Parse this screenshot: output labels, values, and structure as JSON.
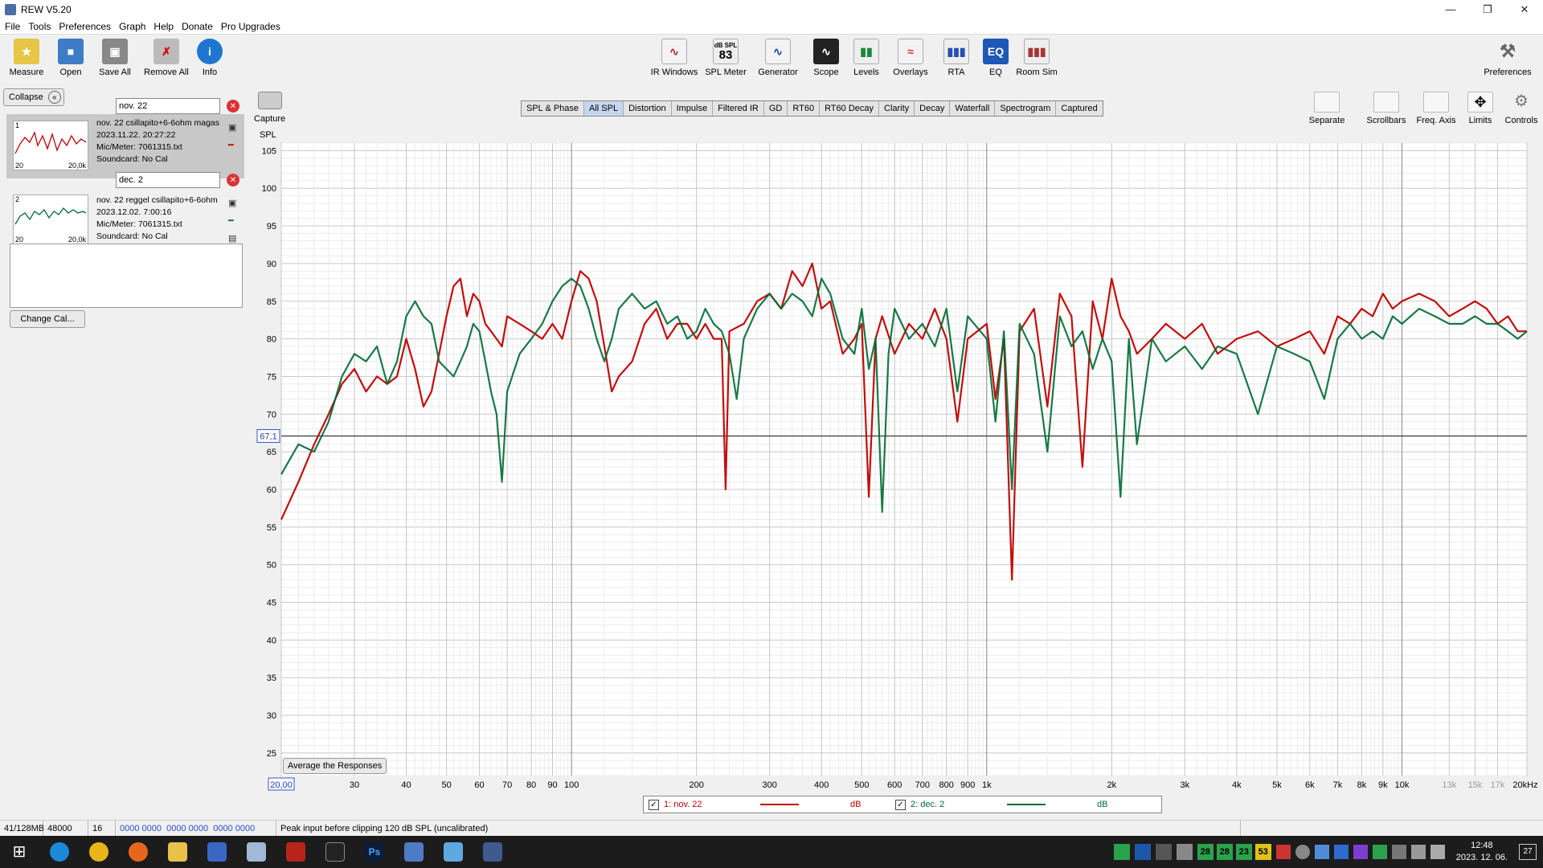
{
  "window": {
    "title": "REW V5.20"
  },
  "menu": [
    "File",
    "Tools",
    "Preferences",
    "Graph",
    "Help",
    "Donate",
    "Pro Upgrades"
  ],
  "toolbar_left": [
    {
      "label": "Measure",
      "icon": "measure-icon"
    },
    {
      "label": "Open",
      "icon": "folder-icon"
    },
    {
      "label": "Save All",
      "icon": "save-icon"
    },
    {
      "label": "Remove All",
      "icon": "remove-icon"
    },
    {
      "label": "Info",
      "icon": "info-icon"
    }
  ],
  "toolbar_center": [
    {
      "label": "IR Windows",
      "icon": "ir-windows-icon"
    },
    {
      "label": "SPL Meter",
      "icon": "spl-meter-icon",
      "badge_top": "dB SPL",
      "badge_value": "83"
    },
    {
      "label": "Generator",
      "icon": "generator-icon"
    },
    {
      "label": "Scope",
      "icon": "scope-icon"
    },
    {
      "label": "Levels",
      "icon": "levels-icon"
    },
    {
      "label": "Overlays",
      "icon": "overlays-icon"
    },
    {
      "label": "RTA",
      "icon": "rta-icon"
    },
    {
      "label": "EQ",
      "icon": "eq-icon"
    },
    {
      "label": "Room Sim",
      "icon": "room-sim-icon"
    }
  ],
  "toolbar_right": {
    "label": "Preferences",
    "icon": "wrench-icon"
  },
  "panel": {
    "collapse_label": "Collapse",
    "measurements": [
      {
        "name": "nov. 22",
        "index": "1",
        "info": [
          "nov. 22 csillapito+6-6ohm magas",
          "2023.11.22. 20:27:22",
          "Mic/Meter: 7061315.txt",
          "Soundcard: No Cal"
        ],
        "thumb_left": "20",
        "thumb_right": "20,0k",
        "color": "#c00000"
      },
      {
        "name": "dec. 2",
        "index": "2",
        "info": [
          "nov. 22 reggel csillapito+6-6ohm",
          "2023.12.02. 7:00:16",
          "Mic/Meter: 7061315.txt",
          "Soundcard: No Cal"
        ],
        "thumb_left": "20",
        "thumb_right": "20,0k",
        "color": "#006a33"
      }
    ],
    "change_cal_label": "Change Cal..."
  },
  "capture_label": "Capture",
  "tabs": [
    "SPL & Phase",
    "All SPL",
    "Distortion",
    "Impulse",
    "Filtered IR",
    "GD",
    "RT60",
    "RT60 Decay",
    "Clarity",
    "Decay",
    "Waterfall",
    "Spectrogram",
    "Captured"
  ],
  "active_tab": "All SPL",
  "graph_tools": [
    {
      "label": "Separate",
      "icon": "separate-icon"
    },
    {
      "label": "Scrollbars",
      "icon": "scrollbars-icon"
    },
    {
      "label": "Freq. Axis",
      "icon": "freq-axis-icon"
    },
    {
      "label": "Limits",
      "icon": "limits-icon"
    },
    {
      "label": "Controls",
      "icon": "gear-icon"
    }
  ],
  "chart_data": {
    "type": "line",
    "ylabel": "SPL",
    "x_scale": "log",
    "xlim": [
      20,
      20000
    ],
    "ylim": [
      22,
      106
    ],
    "y_ticks": [
      25,
      30,
      35,
      40,
      45,
      50,
      55,
      60,
      65,
      70,
      75,
      80,
      85,
      90,
      95,
      100,
      105
    ],
    "x_ticks": [
      {
        "v": 20,
        "t": "20,00"
      },
      {
        "v": 30,
        "t": "30"
      },
      {
        "v": 40,
        "t": "40"
      },
      {
        "v": 50,
        "t": "50"
      },
      {
        "v": 60,
        "t": "60"
      },
      {
        "v": 70,
        "t": "70"
      },
      {
        "v": 80,
        "t": "80"
      },
      {
        "v": 90,
        "t": "90"
      },
      {
        "v": 100,
        "t": "100"
      },
      {
        "v": 200,
        "t": "200"
      },
      {
        "v": 300,
        "t": "300"
      },
      {
        "v": 400,
        "t": "400"
      },
      {
        "v": 500,
        "t": "500"
      },
      {
        "v": 600,
        "t": "600"
      },
      {
        "v": 700,
        "t": "700"
      },
      {
        "v": 800,
        "t": "800"
      },
      {
        "v": 900,
        "t": "900"
      },
      {
        "v": 1000,
        "t": "1k"
      },
      {
        "v": 2000,
        "t": "2k"
      },
      {
        "v": 3000,
        "t": "3k"
      },
      {
        "v": 4000,
        "t": "4k"
      },
      {
        "v": 5000,
        "t": "5k"
      },
      {
        "v": 6000,
        "t": "6k"
      },
      {
        "v": 7000,
        "t": "7k"
      },
      {
        "v": 8000,
        "t": "8k"
      },
      {
        "v": 9000,
        "t": "9k"
      },
      {
        "v": 10000,
        "t": "10k"
      },
      {
        "v": 13000,
        "t": "13k",
        "grey": true
      },
      {
        "v": 15000,
        "t": "15k",
        "grey": true
      },
      {
        "v": 17000,
        "t": "17k",
        "grey": true
      },
      {
        "v": 20000,
        "t": "20kHz"
      }
    ],
    "cursor_y": 67.1,
    "cursor_label": "67,1",
    "series": [
      {
        "name": "1: nov. 22",
        "unit": "dB",
        "color": "#c00000",
        "points": [
          [
            20,
            56
          ],
          [
            22,
            61
          ],
          [
            24,
            66
          ],
          [
            26,
            70
          ],
          [
            28,
            74
          ],
          [
            30,
            76
          ],
          [
            32,
            73
          ],
          [
            34,
            75
          ],
          [
            36,
            74
          ],
          [
            38,
            75
          ],
          [
            40,
            80
          ],
          [
            42,
            76
          ],
          [
            44,
            71
          ],
          [
            46,
            73
          ],
          [
            48,
            78
          ],
          [
            50,
            83
          ],
          [
            52,
            87
          ],
          [
            54,
            88
          ],
          [
            56,
            83
          ],
          [
            58,
            86
          ],
          [
            60,
            85
          ],
          [
            62,
            82
          ],
          [
            64,
            81
          ],
          [
            66,
            80
          ],
          [
            68,
            79
          ],
          [
            70,
            83
          ],
          [
            75,
            82
          ],
          [
            80,
            81
          ],
          [
            85,
            80
          ],
          [
            90,
            82
          ],
          [
            95,
            80
          ],
          [
            100,
            85
          ],
          [
            105,
            89
          ],
          [
            110,
            88
          ],
          [
            115,
            85
          ],
          [
            120,
            79
          ],
          [
            125,
            73
          ],
          [
            130,
            75
          ],
          [
            140,
            77
          ],
          [
            150,
            82
          ],
          [
            160,
            84
          ],
          [
            170,
            80
          ],
          [
            180,
            82
          ],
          [
            190,
            82
          ],
          [
            200,
            80
          ],
          [
            210,
            82
          ],
          [
            220,
            80
          ],
          [
            230,
            80
          ],
          [
            235,
            60
          ],
          [
            240,
            81
          ],
          [
            260,
            82
          ],
          [
            280,
            85
          ],
          [
            300,
            86
          ],
          [
            320,
            84
          ],
          [
            340,
            89
          ],
          [
            360,
            87
          ],
          [
            380,
            90
          ],
          [
            400,
            84
          ],
          [
            420,
            85
          ],
          [
            450,
            78
          ],
          [
            480,
            80
          ],
          [
            500,
            82
          ],
          [
            520,
            59
          ],
          [
            540,
            80
          ],
          [
            560,
            83
          ],
          [
            600,
            78
          ],
          [
            650,
            82
          ],
          [
            700,
            80
          ],
          [
            750,
            84
          ],
          [
            800,
            80
          ],
          [
            850,
            69
          ],
          [
            900,
            80
          ],
          [
            1000,
            82
          ],
          [
            1050,
            72
          ],
          [
            1100,
            80
          ],
          [
            1150,
            48
          ],
          [
            1200,
            81
          ],
          [
            1300,
            84
          ],
          [
            1400,
            71
          ],
          [
            1500,
            86
          ],
          [
            1600,
            83
          ],
          [
            1700,
            63
          ],
          [
            1800,
            85
          ],
          [
            1900,
            80
          ],
          [
            2000,
            88
          ],
          [
            2100,
            83
          ],
          [
            2200,
            81
          ],
          [
            2300,
            78
          ],
          [
            2500,
            80
          ],
          [
            2700,
            82
          ],
          [
            3000,
            80
          ],
          [
            3300,
            82
          ],
          [
            3600,
            78
          ],
          [
            4000,
            80
          ],
          [
            4500,
            81
          ],
          [
            5000,
            79
          ],
          [
            5500,
            80
          ],
          [
            6000,
            81
          ],
          [
            6500,
            78
          ],
          [
            7000,
            83
          ],
          [
            7500,
            82
          ],
          [
            8000,
            84
          ],
          [
            8500,
            83
          ],
          [
            9000,
            86
          ],
          [
            9500,
            84
          ],
          [
            10000,
            85
          ],
          [
            11000,
            86
          ],
          [
            12000,
            85
          ],
          [
            13000,
            83
          ],
          [
            14000,
            84
          ],
          [
            15000,
            85
          ],
          [
            16000,
            84
          ],
          [
            17000,
            82
          ],
          [
            18000,
            83
          ],
          [
            19000,
            81
          ],
          [
            20000,
            81
          ]
        ]
      },
      {
        "name": "2: dec. 2",
        "unit": "dB",
        "color": "#006a33",
        "points": [
          [
            20,
            62
          ],
          [
            22,
            66
          ],
          [
            24,
            65
          ],
          [
            26,
            69
          ],
          [
            28,
            75
          ],
          [
            30,
            78
          ],
          [
            32,
            77
          ],
          [
            34,
            79
          ],
          [
            36,
            74
          ],
          [
            38,
            77
          ],
          [
            40,
            83
          ],
          [
            42,
            85
          ],
          [
            44,
            83
          ],
          [
            46,
            82
          ],
          [
            48,
            77
          ],
          [
            50,
            76
          ],
          [
            52,
            75
          ],
          [
            54,
            77
          ],
          [
            56,
            79
          ],
          [
            58,
            82
          ],
          [
            60,
            81
          ],
          [
            62,
            77
          ],
          [
            64,
            73
          ],
          [
            66,
            70
          ],
          [
            68,
            61
          ],
          [
            70,
            73
          ],
          [
            75,
            78
          ],
          [
            80,
            80
          ],
          [
            85,
            82
          ],
          [
            90,
            85
          ],
          [
            95,
            87
          ],
          [
            100,
            88
          ],
          [
            105,
            87
          ],
          [
            110,
            84
          ],
          [
            115,
            80
          ],
          [
            120,
            77
          ],
          [
            125,
            80
          ],
          [
            130,
            84
          ],
          [
            140,
            86
          ],
          [
            150,
            84
          ],
          [
            160,
            85
          ],
          [
            170,
            82
          ],
          [
            180,
            83
          ],
          [
            190,
            80
          ],
          [
            200,
            81
          ],
          [
            210,
            84
          ],
          [
            220,
            82
          ],
          [
            230,
            81
          ],
          [
            240,
            78
          ],
          [
            250,
            72
          ],
          [
            260,
            80
          ],
          [
            280,
            84
          ],
          [
            300,
            86
          ],
          [
            320,
            84
          ],
          [
            340,
            86
          ],
          [
            360,
            85
          ],
          [
            380,
            83
          ],
          [
            400,
            88
          ],
          [
            420,
            86
          ],
          [
            450,
            80
          ],
          [
            480,
            78
          ],
          [
            500,
            84
          ],
          [
            520,
            76
          ],
          [
            540,
            80
          ],
          [
            560,
            57
          ],
          [
            580,
            78
          ],
          [
            600,
            84
          ],
          [
            650,
            80
          ],
          [
            700,
            82
          ],
          [
            750,
            79
          ],
          [
            800,
            84
          ],
          [
            850,
            73
          ],
          [
            900,
            83
          ],
          [
            1000,
            80
          ],
          [
            1050,
            69
          ],
          [
            1100,
            81
          ],
          [
            1150,
            60
          ],
          [
            1200,
            82
          ],
          [
            1300,
            78
          ],
          [
            1400,
            65
          ],
          [
            1500,
            83
          ],
          [
            1600,
            79
          ],
          [
            1700,
            81
          ],
          [
            1800,
            76
          ],
          [
            1900,
            80
          ],
          [
            2000,
            77
          ],
          [
            2100,
            59
          ],
          [
            2200,
            80
          ],
          [
            2300,
            66
          ],
          [
            2500,
            80
          ],
          [
            2700,
            77
          ],
          [
            3000,
            79
          ],
          [
            3300,
            76
          ],
          [
            3600,
            79
          ],
          [
            4000,
            78
          ],
          [
            4500,
            70
          ],
          [
            5000,
            79
          ],
          [
            5500,
            78
          ],
          [
            6000,
            77
          ],
          [
            6500,
            72
          ],
          [
            7000,
            80
          ],
          [
            7500,
            82
          ],
          [
            8000,
            80
          ],
          [
            8500,
            81
          ],
          [
            9000,
            80
          ],
          [
            9500,
            83
          ],
          [
            10000,
            82
          ],
          [
            11000,
            84
          ],
          [
            12000,
            83
          ],
          [
            13000,
            82
          ],
          [
            14000,
            82
          ],
          [
            15000,
            83
          ],
          [
            16000,
            82
          ],
          [
            17000,
            82
          ],
          [
            18000,
            81
          ],
          [
            19000,
            80
          ],
          [
            20000,
            81
          ]
        ]
      }
    ]
  },
  "avg_button_label": "Average the Responses",
  "legend": [
    {
      "check": "✓",
      "name": "1: nov. 22",
      "unit": "dB",
      "color": "#c00000"
    },
    {
      "check": "✓",
      "name": "2: dec. 2",
      "unit": "dB",
      "color": "#006a33"
    }
  ],
  "status": [
    "41/128MB",
    "48000 Hz",
    "16 Bit",
    "0000 0000  0000 0000  0000 0000",
    "Peak input before clipping 120 dB SPL (uncalibrated)"
  ],
  "taskbar": {
    "tray_numbers": [
      "28",
      "28",
      "23",
      "53"
    ],
    "time": "12:48",
    "date": "2023. 12. 06.",
    "notif": "27"
  }
}
